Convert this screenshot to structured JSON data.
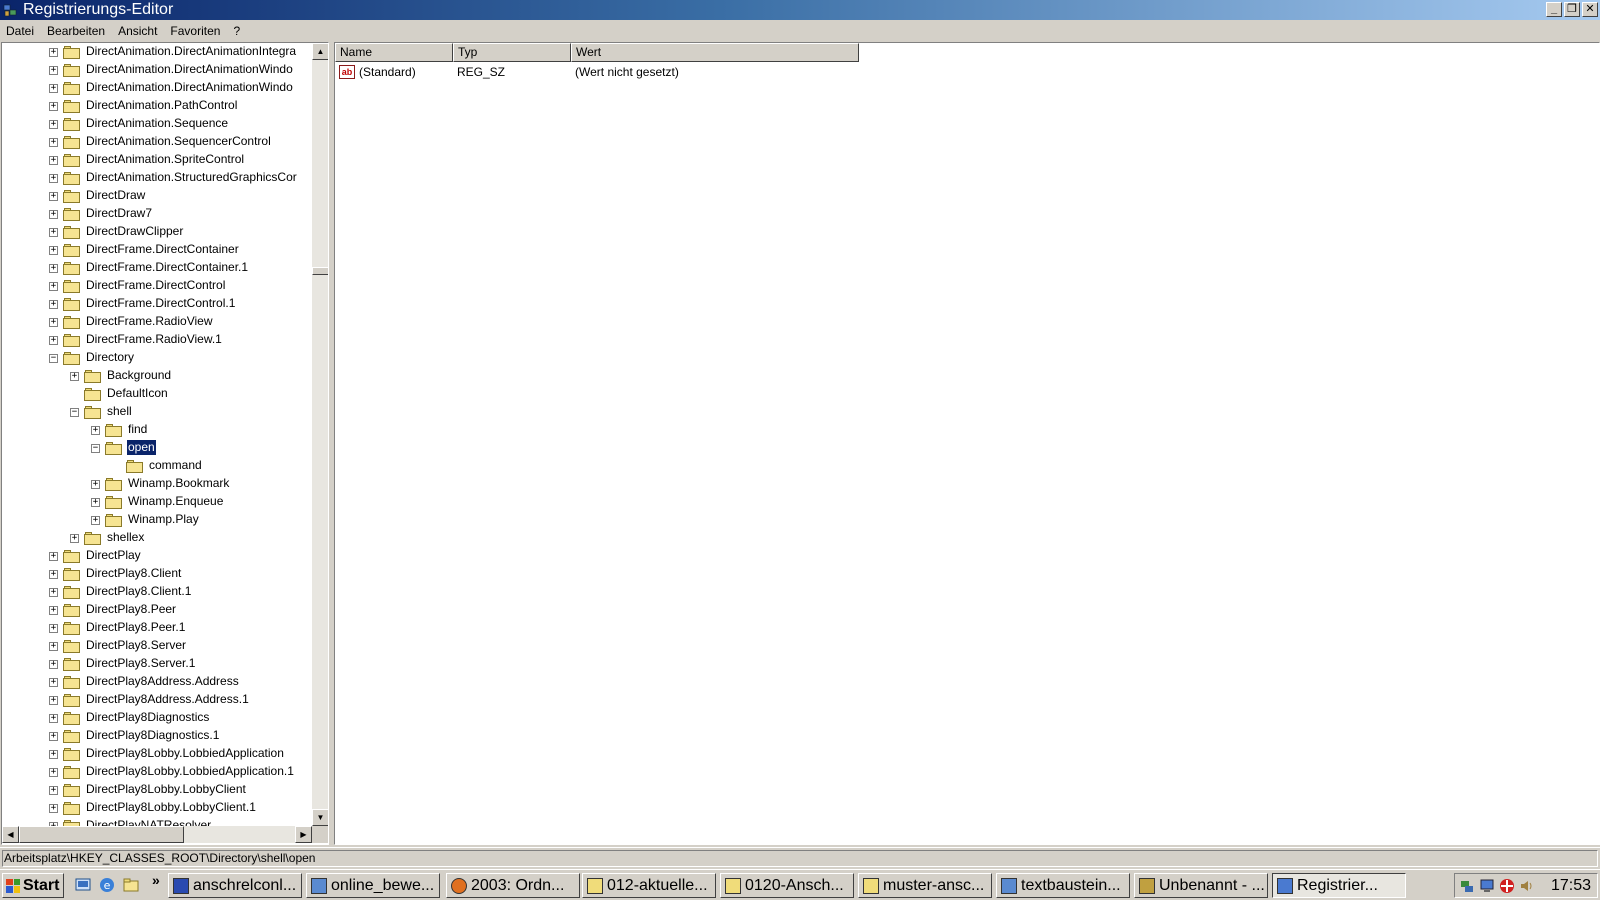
{
  "window": {
    "title": "Registrierungs-Editor"
  },
  "window_controls": {
    "minimize": "_",
    "restore": "❐",
    "close": "✕"
  },
  "menu": [
    {
      "label": "Datei"
    },
    {
      "label": "Bearbeiten"
    },
    {
      "label": "Ansicht"
    },
    {
      "label": "Favoriten"
    },
    {
      "label": "?"
    }
  ],
  "tree": {
    "nodes": [
      {
        "label": "DirectAnimation.DirectAnimationIntegra",
        "level": 0,
        "expander": "+"
      },
      {
        "label": "DirectAnimation.DirectAnimationWindo",
        "level": 0,
        "expander": "+"
      },
      {
        "label": "DirectAnimation.DirectAnimationWindo",
        "level": 0,
        "expander": "+"
      },
      {
        "label": "DirectAnimation.PathControl",
        "level": 0,
        "expander": "+"
      },
      {
        "label": "DirectAnimation.Sequence",
        "level": 0,
        "expander": "+"
      },
      {
        "label": "DirectAnimation.SequencerControl",
        "level": 0,
        "expander": "+"
      },
      {
        "label": "DirectAnimation.SpriteControl",
        "level": 0,
        "expander": "+"
      },
      {
        "label": "DirectAnimation.StructuredGraphicsCor",
        "level": 0,
        "expander": "+"
      },
      {
        "label": "DirectDraw",
        "level": 0,
        "expander": "+"
      },
      {
        "label": "DirectDraw7",
        "level": 0,
        "expander": "+"
      },
      {
        "label": "DirectDrawClipper",
        "level": 0,
        "expander": "+"
      },
      {
        "label": "DirectFrame.DirectContainer",
        "level": 0,
        "expander": "+"
      },
      {
        "label": "DirectFrame.DirectContainer.1",
        "level": 0,
        "expander": "+"
      },
      {
        "label": "DirectFrame.DirectControl",
        "level": 0,
        "expander": "+"
      },
      {
        "label": "DirectFrame.DirectControl.1",
        "level": 0,
        "expander": "+"
      },
      {
        "label": "DirectFrame.RadioView",
        "level": 0,
        "expander": "+"
      },
      {
        "label": "DirectFrame.RadioView.1",
        "level": 0,
        "expander": "+"
      },
      {
        "label": "Directory",
        "level": 0,
        "expander": "-"
      },
      {
        "label": "Background",
        "level": 1,
        "expander": "+"
      },
      {
        "label": "DefaultIcon",
        "level": 1,
        "expander": ""
      },
      {
        "label": "shell",
        "level": 1,
        "expander": "-"
      },
      {
        "label": "find",
        "level": 2,
        "expander": "+"
      },
      {
        "label": "open",
        "level": 2,
        "expander": "-",
        "selected": true
      },
      {
        "label": "command",
        "level": 3,
        "expander": ""
      },
      {
        "label": "Winamp.Bookmark",
        "level": 2,
        "expander": "+"
      },
      {
        "label": "Winamp.Enqueue",
        "level": 2,
        "expander": "+"
      },
      {
        "label": "Winamp.Play",
        "level": 2,
        "expander": "+"
      },
      {
        "label": "shellex",
        "level": 1,
        "expander": "+"
      },
      {
        "label": "DirectPlay",
        "level": 0,
        "expander": "+"
      },
      {
        "label": "DirectPlay8.Client",
        "level": 0,
        "expander": "+"
      },
      {
        "label": "DirectPlay8.Client.1",
        "level": 0,
        "expander": "+"
      },
      {
        "label": "DirectPlay8.Peer",
        "level": 0,
        "expander": "+"
      },
      {
        "label": "DirectPlay8.Peer.1",
        "level": 0,
        "expander": "+"
      },
      {
        "label": "DirectPlay8.Server",
        "level": 0,
        "expander": "+"
      },
      {
        "label": "DirectPlay8.Server.1",
        "level": 0,
        "expander": "+"
      },
      {
        "label": "DirectPlay8Address.Address",
        "level": 0,
        "expander": "+"
      },
      {
        "label": "DirectPlay8Address.Address.1",
        "level": 0,
        "expander": "+"
      },
      {
        "label": "DirectPlay8Diagnostics",
        "level": 0,
        "expander": "+"
      },
      {
        "label": "DirectPlay8Diagnostics.1",
        "level": 0,
        "expander": "+"
      },
      {
        "label": "DirectPlay8Lobby.LobbiedApplication",
        "level": 0,
        "expander": "+"
      },
      {
        "label": "DirectPlay8Lobby.LobbiedApplication.1",
        "level": 0,
        "expander": "+"
      },
      {
        "label": "DirectPlay8Lobby.LobbyClient",
        "level": 0,
        "expander": "+"
      },
      {
        "label": "DirectPlay8Lobby.LobbyClient.1",
        "level": 0,
        "expander": "+"
      },
      {
        "label": "DirectPlayNATResolver",
        "level": 0,
        "expander": "+"
      }
    ]
  },
  "list": {
    "columns": [
      {
        "label": "Name"
      },
      {
        "label": "Typ"
      },
      {
        "label": "Wert"
      }
    ],
    "rows": [
      {
        "name": "(Standard)",
        "type": "REG_SZ",
        "value": "(Wert nicht gesetzt)",
        "icon": "ab"
      }
    ]
  },
  "statusbar": {
    "path": "Arbeitsplatz\\HKEY_CLASSES_ROOT\\Directory\\shell\\open"
  },
  "taskbar": {
    "start_label": "Start",
    "quicklaunch_chevron": "»",
    "tasks": [
      {
        "label": "anschrelconl...",
        "icon": "word-doc-icon"
      },
      {
        "label": "online_bewe...",
        "icon": "document-icon"
      },
      {
        "label": "2003: Ordn...",
        "icon": "firefox-icon"
      },
      {
        "label": "012-aktuelle...",
        "icon": "folder-icon"
      },
      {
        "label": "0120-Ansch...",
        "icon": "folder-icon"
      },
      {
        "label": "muster-ansc...",
        "icon": "folder-icon"
      },
      {
        "label": "textbaustein...",
        "icon": "document-icon"
      },
      {
        "label": "Unbenannt - ...",
        "icon": "paint-icon"
      },
      {
        "label": "Registrier...",
        "icon": "regedit-icon",
        "active": true
      }
    ],
    "clock": "17:53"
  },
  "colors": {
    "selection": "#0a246a",
    "window_face": "#d4d0c8",
    "folder_fill": "#f6e492"
  }
}
